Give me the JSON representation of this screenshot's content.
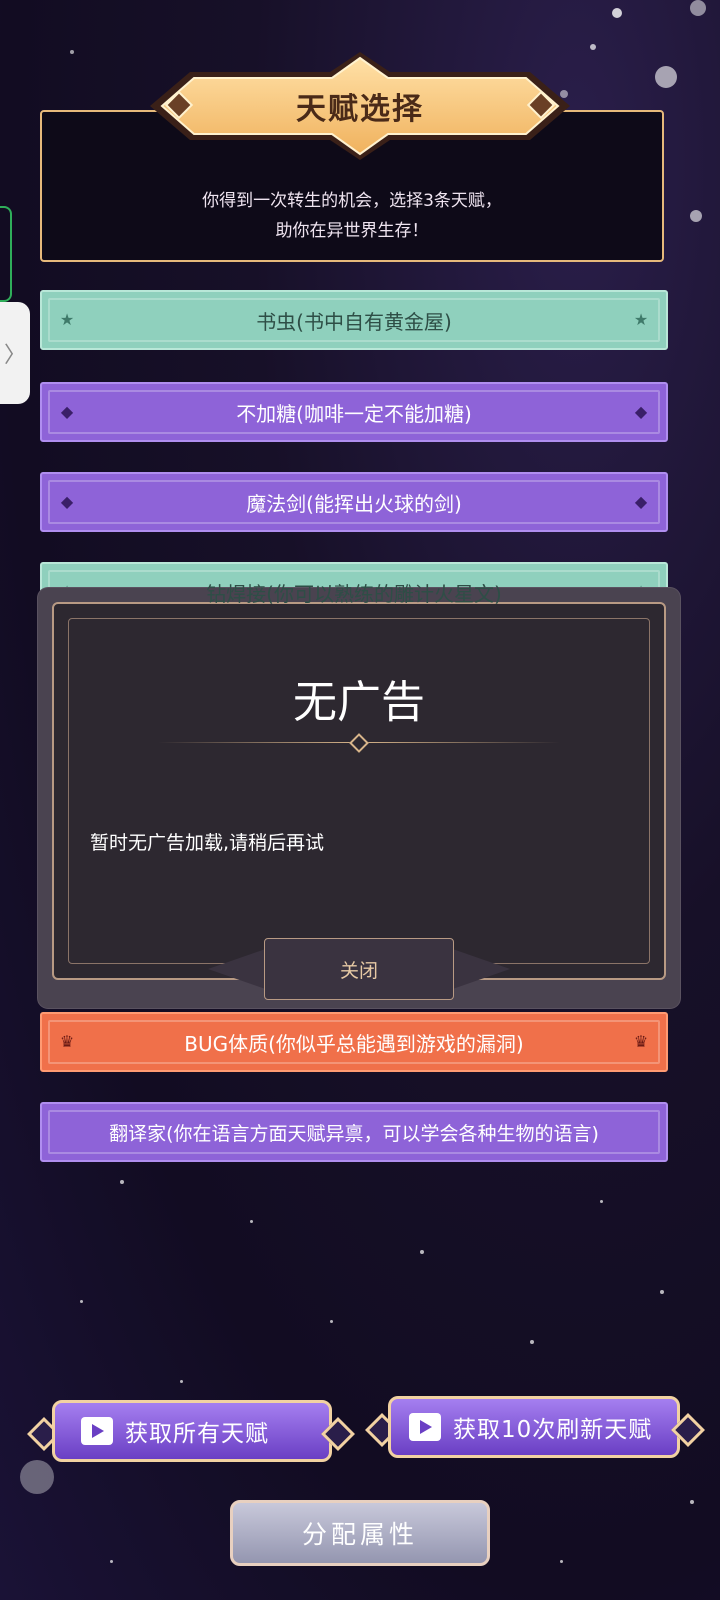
{
  "header": {
    "title": "天赋选择",
    "intro_line1": "你得到一次转生的机会，选择3条天赋，",
    "intro_line2": "助你在异世界生存！"
  },
  "talents": [
    {
      "label": "书虫(书中自有黄金屋)",
      "rarity": "green",
      "icon": "star-icon"
    },
    {
      "label": "不加糖(咖啡一定不能加糖)",
      "rarity": "purple",
      "icon": "diamond-icon"
    },
    {
      "label": "魔法剑(能挥出火球的剑)",
      "rarity": "purple",
      "icon": "diamond-icon"
    },
    {
      "label": "钻焊接(你可以熟练的雕计火星文)",
      "rarity": "green",
      "icon": "star-icon"
    },
    {
      "label": "BUG体质(你似乎总能遇到游戏的漏洞)",
      "rarity": "orange",
      "icon": "crown-icon"
    },
    {
      "label": "翻译家(你在语言方面天赋异禀，可以学会各种生物的语言)",
      "rarity": "purple",
      "icon": "diamond-icon"
    }
  ],
  "modal": {
    "title": "无广告",
    "message": "暂时无广告加载,请稍后再试",
    "close_label": "关闭"
  },
  "side_tab": {
    "chevron": "〉"
  },
  "buttons": {
    "get_all_talents": "获取所有天赋",
    "get_10_refresh": "获取10次刷新天赋",
    "allocate_attributes": "分配属性"
  },
  "colors": {
    "green": "#8fd0bd",
    "purple": "#8e63d8",
    "orange": "#f0704a",
    "gold": "#e6b97b"
  }
}
